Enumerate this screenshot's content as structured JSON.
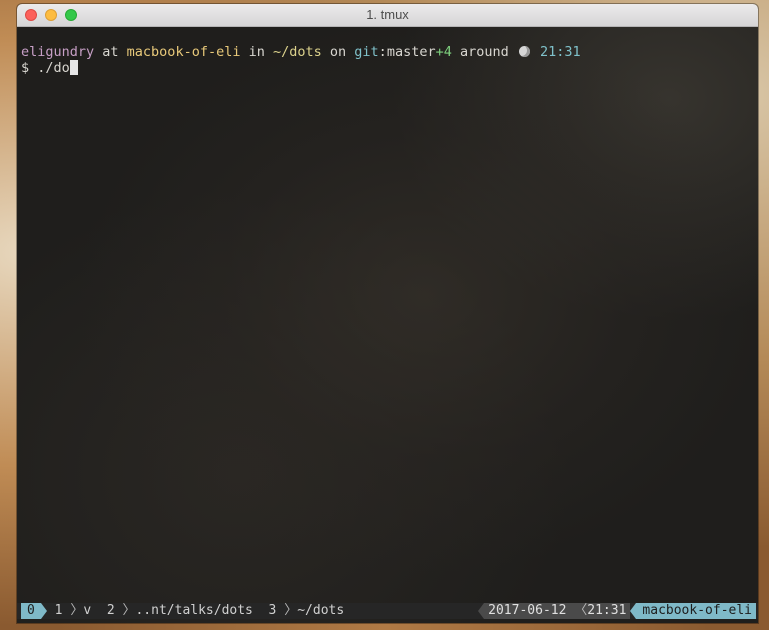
{
  "window": {
    "title": "1. tmux"
  },
  "prompt": {
    "user": "eligundry",
    "at": " at ",
    "host": "macbook-of-eli",
    "in": " in ",
    "path": "~/dots",
    "on": " on ",
    "git_label": "git",
    "colon": ":",
    "branch": "master",
    "ahead": "+4",
    "around": " around ",
    "time": "21:31",
    "time_icon": "moon-icon"
  },
  "command": {
    "dollar": "$ ",
    "text": "./do"
  },
  "statusbar": {
    "active_window": "0",
    "windows": [
      {
        "index": "1",
        "name": "v"
      },
      {
        "index": "2",
        "name": "..nt/talks/dots"
      },
      {
        "index": "3",
        "name": "~/dots"
      }
    ],
    "date": "2017-06-12",
    "time": "21:31",
    "host": "macbook-of-eli"
  },
  "colors": {
    "accent": "#7fb9c8",
    "user": "#c79fc6",
    "host": "#e8c97a",
    "git": "#7fc1ca",
    "ahead": "#7ed07e"
  }
}
